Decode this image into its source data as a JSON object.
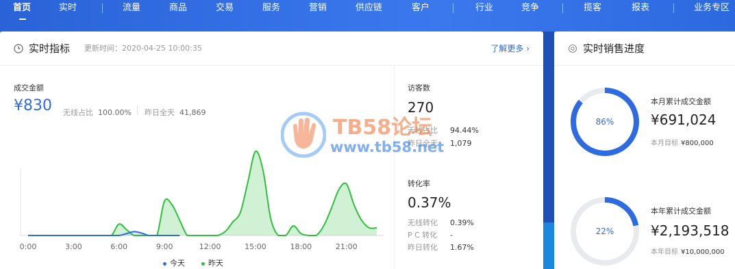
{
  "nav": {
    "items": [
      "首页",
      "实时",
      "流量",
      "商品",
      "交易",
      "服务",
      "营销",
      "供应链",
      "客户",
      "行业",
      "竞争",
      "揽客",
      "报表",
      "业务专区"
    ],
    "active": "首页"
  },
  "realtime": {
    "title": "实时指标",
    "update_label": "更新时间：",
    "update_time": "2020-04-25 10:00:35",
    "more": "了解更多 ›"
  },
  "gmv": {
    "label": "成交金额",
    "value": "¥830",
    "wireless_label": "无线占比",
    "wireless_value": "100.00%",
    "yesterday_label": "昨日全天",
    "yesterday_value": "41,869"
  },
  "visitors": {
    "label": "访客数",
    "value": "270",
    "wireless_label": "无线占比",
    "wireless_value": "94.44%",
    "yesterday_label": "昨日全天",
    "yesterday_value": "1,079"
  },
  "conversion": {
    "label": "转化率",
    "value": "0.37%",
    "wireless_label": "无线转化",
    "wireless_value": "0.39%",
    "pc_label": "P C 转化",
    "pc_value": "-",
    "yesterday_label": "昨日转化",
    "yesterday_value": "1.67%"
  },
  "sales_progress": {
    "title": "实时销售进度",
    "month": {
      "label": "本月累计成交金额",
      "value": "¥691,024",
      "target_label": "本月目标",
      "target_value": "¥800,000",
      "percent": "86%",
      "fraction": 0.86
    },
    "year": {
      "label": "本年累计成交金额",
      "value": "¥2,193,518",
      "target_label": "本年目标",
      "target_value": "¥10,000,000",
      "percent": "22%",
      "fraction": 0.22
    }
  },
  "watermark": {
    "line1": "TB58论坛",
    "line2": "www.tb58.net"
  },
  "colors": {
    "accent": "#2f6be0",
    "today": "#2f6be0",
    "yesterday": "#2ec03c",
    "ring_track": "#e8eaee"
  },
  "chart_data": {
    "type": "area",
    "x_ticks": [
      "0:00",
      "3:00",
      "6:00",
      "9:00",
      "12:00",
      "15:00",
      "18:00",
      "21:00"
    ],
    "series": [
      {
        "name": "今天",
        "x": [
          0,
          1,
          2,
          3,
          4,
          5,
          6,
          6.5,
          7,
          7.5,
          8,
          9,
          10
        ],
        "values": [
          0,
          0,
          0,
          0,
          0,
          0,
          0,
          50,
          100,
          60,
          0,
          0,
          0
        ]
      },
      {
        "name": "昨天",
        "x": [
          0,
          1,
          2,
          3,
          4,
          5,
          5.5,
          6,
          6.5,
          7,
          7.5,
          8,
          8.5,
          9,
          9.5,
          10,
          10.5,
          11,
          11.5,
          12,
          12.5,
          13,
          13.5,
          14,
          14.5,
          15,
          15.5,
          16,
          16.5,
          17,
          17.5,
          18,
          18.5,
          19,
          19.5,
          20,
          20.5,
          21,
          21.5,
          22,
          22.5,
          23
        ],
        "values": [
          0,
          0,
          0,
          0,
          0,
          0,
          0,
          300,
          150,
          0,
          0,
          0,
          0,
          900,
          800,
          400,
          0,
          0,
          0,
          0,
          0,
          100,
          350,
          600,
          1400,
          2200,
          1700,
          450,
          0,
          0,
          250,
          50,
          0,
          0,
          250,
          700,
          1200,
          1350,
          800,
          400,
          200,
          200
        ]
      }
    ],
    "legend": [
      "今天",
      "昨天"
    ],
    "legend_position": "bottom-center"
  }
}
